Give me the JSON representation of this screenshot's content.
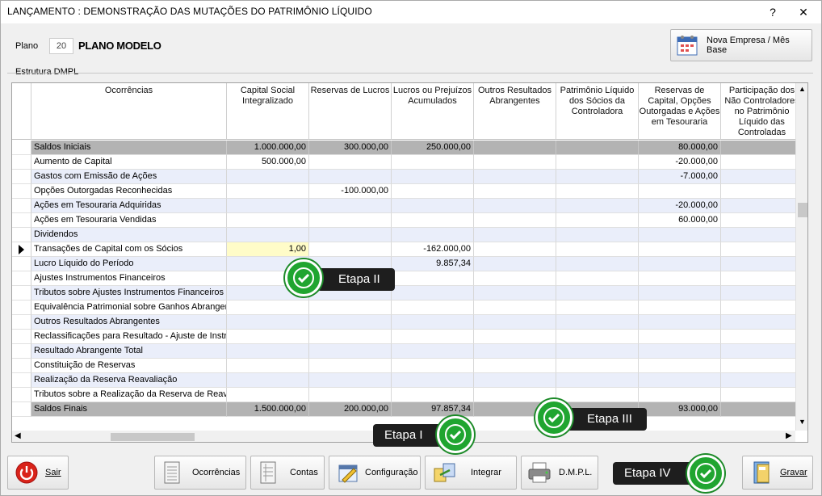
{
  "window": {
    "title": "LANÇAMENTO : DEMONSTRAÇÃO DAS MUTAÇÕES DO PATRIMÔNIO LÍQUIDO",
    "help": "?",
    "close": "✕"
  },
  "plan": {
    "label": "Plano",
    "number": "20",
    "name": "PLANO MODELO"
  },
  "nova_empresa_label": "Nova Empresa / Mês Base",
  "group_label": "Estrutura DMPL",
  "columns": [
    "Ocorrências",
    "Capital Social Integralizado",
    "Reservas de Lucros",
    "Lucros ou Prejuízos Acumulados",
    "Outros Resultados Abrangentes",
    "Patrimônio Líquido dos Sócios da Controladora",
    "Reservas de Capital, Opções Outorgadas e Ações em Tesouraria",
    "Participação dos Não Controladores no Patrimônio Líquido das Controladas"
  ],
  "rows": [
    {
      "name": "Saldos Iniciais",
      "vals": [
        "1.000.000,00",
        "300.000,00",
        "250.000,00",
        "",
        "",
        "80.000,00",
        ""
      ],
      "style": "gray"
    },
    {
      "name": "Aumento de Capital",
      "vals": [
        "500.000,00",
        "",
        "",
        "",
        "",
        "-20.000,00",
        ""
      ],
      "style": ""
    },
    {
      "name": "Gastos com Emissão de Ações",
      "vals": [
        "",
        "",
        "",
        "",
        "",
        "-7.000,00",
        ""
      ],
      "style": "alt"
    },
    {
      "name": "Opções Outorgadas Reconhecidas",
      "vals": [
        "",
        "-100.000,00",
        "",
        "",
        "",
        "",
        ""
      ],
      "style": ""
    },
    {
      "name": "Ações em Tesouraria Adquiridas",
      "vals": [
        "",
        "",
        "",
        "",
        "",
        "-20.000,00",
        ""
      ],
      "style": "alt"
    },
    {
      "name": "Ações em Tesouraria Vendidas",
      "vals": [
        "",
        "",
        "",
        "",
        "",
        "60.000,00",
        ""
      ],
      "style": ""
    },
    {
      "name": "Dividendos",
      "vals": [
        "",
        "",
        "",
        "",
        "",
        "",
        ""
      ],
      "style": "alt"
    },
    {
      "name": "Transações de Capital com os Sócios",
      "vals": [
        "1,00",
        "",
        "-162.000,00",
        "",
        "",
        "",
        ""
      ],
      "style": "",
      "current": true
    },
    {
      "name": "Lucro Líquido do Período",
      "vals": [
        "",
        "",
        "9.857,34",
        "",
        "",
        "",
        ""
      ],
      "style": "alt"
    },
    {
      "name": "Ajustes Instrumentos Financeiros",
      "vals": [
        "",
        "",
        "",
        "",
        "",
        "",
        ""
      ],
      "style": ""
    },
    {
      "name": "Tributos sobre Ajustes Instrumentos Financeiros",
      "vals": [
        "",
        "",
        "",
        "",
        "",
        "",
        ""
      ],
      "style": "alt"
    },
    {
      "name": "Equivalência Patrimonial sobre Ganhos Abrangentes",
      "vals": [
        "",
        "",
        "",
        "",
        "",
        "",
        ""
      ],
      "style": ""
    },
    {
      "name": "Outros Resultados Abrangentes",
      "vals": [
        "",
        "",
        "",
        "",
        "",
        "",
        ""
      ],
      "style": "alt"
    },
    {
      "name": "Reclassificações para Resultado - Ajuste de Instrumentos",
      "vals": [
        "",
        "",
        "",
        "",
        "",
        "",
        ""
      ],
      "style": ""
    },
    {
      "name": "Resultado Abrangente Total",
      "vals": [
        "",
        "",
        "",
        "",
        "",
        "",
        ""
      ],
      "style": "alt"
    },
    {
      "name": "Constituição de Reservas",
      "vals": [
        "",
        "",
        "",
        "",
        "",
        "",
        ""
      ],
      "style": ""
    },
    {
      "name": "Realização da Reserva Reavaliação",
      "vals": [
        "",
        "",
        "",
        "",
        "",
        "",
        ""
      ],
      "style": "alt"
    },
    {
      "name": "Tributos sobre a Realização da Reserva de Reavaliação",
      "vals": [
        "",
        "",
        "",
        "",
        "",
        "",
        ""
      ],
      "style": ""
    },
    {
      "name": "Saldos Finais",
      "vals": [
        "1.500.000,00",
        "200.000,00",
        "97.857,34",
        "",
        "",
        "93.000,00",
        ""
      ],
      "style": "gray"
    }
  ],
  "buttons": {
    "sair": "Sair",
    "ocorrencias": "Ocorrências",
    "contas": "Contas",
    "configuracao": "Configuração",
    "integrar": "Integrar",
    "dmpl": "D.M.P.L.",
    "gravar": "Gravar"
  },
  "callouts": {
    "etapa1": "Etapa I",
    "etapa2": "Etapa II",
    "etapa3": "Etapa III",
    "etapa4": "Etapa IV"
  },
  "colors": {
    "gray_row": "#b3b3b3",
    "alt_row": "#eaeefa",
    "check_green": "#20a530",
    "sair_red": "#d9231a"
  }
}
